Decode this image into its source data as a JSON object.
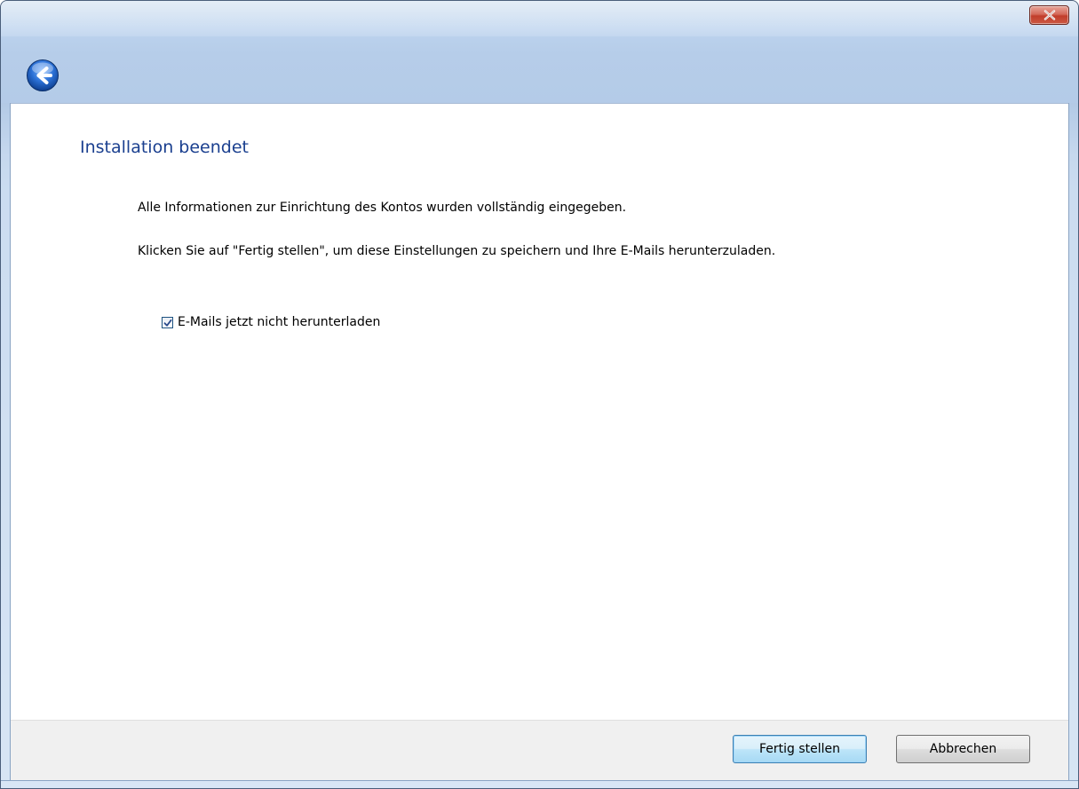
{
  "window": {
    "close_icon": "close-icon",
    "back_icon": "back-arrow-icon"
  },
  "content": {
    "heading": "Installation beendet",
    "paragraph1": "Alle Informationen zur Einrichtung des Kontos wurden vollständig eingegeben.",
    "paragraph2": "Klicken Sie auf \"Fertig stellen\", um diese Einstellungen zu speichern und Ihre E-Mails herunterzuladen.",
    "checkbox": {
      "label": "E-Mails jetzt nicht herunterladen",
      "checked": true
    }
  },
  "footer": {
    "finish_label": "Fertig stellen",
    "cancel_label": "Abbrechen"
  },
  "colors": {
    "heading": "#1a3f8f",
    "close_button": "#c13d2b",
    "back_button": "#2a6fd4",
    "footer_background": "#f0f0f0"
  }
}
